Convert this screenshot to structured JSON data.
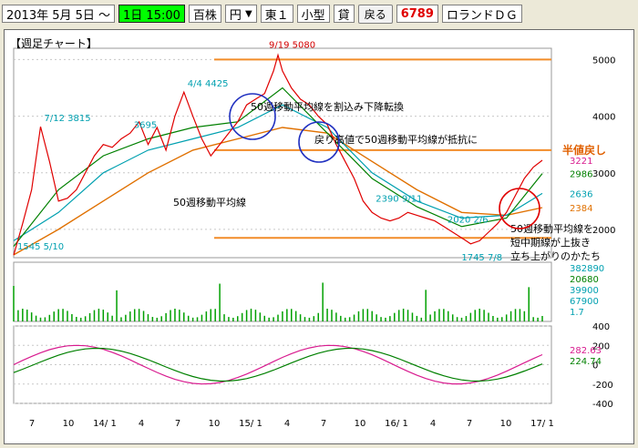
{
  "toolbar": {
    "date": "2013年 5月 5日 ～",
    "period": "1日 15:00",
    "unit_label": "百株",
    "currency": "円",
    "market": "東１",
    "size": "小型",
    "lend": "貸",
    "back_button": "戻る",
    "code": "6789",
    "company": "ロランドＤＧ"
  },
  "chart_data": {
    "type": "line",
    "title": "【週足チャート】",
    "price": {
      "ylim": [
        1500,
        5200
      ],
      "y_ticks": [
        "5000",
        "4000",
        "3000",
        "2000"
      ],
      "y_tick_values": [
        5000,
        4000,
        3000,
        2000
      ],
      "right_values": [
        {
          "text": "3221",
          "value": 3221,
          "color": "#d81b8f"
        },
        {
          "text": "2986",
          "value": 2986,
          "color": "#008000"
        },
        {
          "text": "2636",
          "value": 2636,
          "color": "#00a0b0"
        },
        {
          "text": "2384",
          "value": 2384,
          "color": "#e07000"
        }
      ],
      "price_series": [
        [
          0,
          1545
        ],
        [
          4,
          2100
        ],
        [
          8,
          2700
        ],
        [
          12,
          3815
        ],
        [
          16,
          3200
        ],
        [
          20,
          2500
        ],
        [
          24,
          2550
        ],
        [
          28,
          2700
        ],
        [
          32,
          3000
        ],
        [
          36,
          3300
        ],
        [
          40,
          3500
        ],
        [
          44,
          3450
        ],
        [
          48,
          3600
        ],
        [
          52,
          3700
        ],
        [
          56,
          3900
        ],
        [
          60,
          3500
        ],
        [
          64,
          3800
        ],
        [
          68,
          3400
        ],
        [
          72,
          4000
        ],
        [
          76,
          4425
        ],
        [
          80,
          4000
        ],
        [
          84,
          3600
        ],
        [
          88,
          3300
        ],
        [
          92,
          3500
        ],
        [
          96,
          3700
        ],
        [
          100,
          3900
        ],
        [
          104,
          4200
        ],
        [
          108,
          4300
        ],
        [
          112,
          4400
        ],
        [
          116,
          4800
        ],
        [
          118,
          5080
        ],
        [
          120,
          4800
        ],
        [
          124,
          4500
        ],
        [
          128,
          4300
        ],
        [
          132,
          4200
        ],
        [
          136,
          4000
        ],
        [
          140,
          3850
        ],
        [
          144,
          3500
        ],
        [
          148,
          3200
        ],
        [
          152,
          2900
        ],
        [
          156,
          2500
        ],
        [
          160,
          2300
        ],
        [
          164,
          2200
        ],
        [
          168,
          2150
        ],
        [
          172,
          2200
        ],
        [
          176,
          2300
        ],
        [
          180,
          2250
        ],
        [
          184,
          2200
        ],
        [
          188,
          2150
        ],
        [
          192,
          2050
        ],
        [
          196,
          1950
        ],
        [
          200,
          1850
        ],
        [
          204,
          1745
        ],
        [
          208,
          1800
        ],
        [
          212,
          1950
        ],
        [
          216,
          2100
        ],
        [
          220,
          2300
        ],
        [
          224,
          2600
        ],
        [
          228,
          2900
        ],
        [
          232,
          3100
        ],
        [
          236,
          3221
        ]
      ],
      "ma50": [
        [
          0,
          1550
        ],
        [
          20,
          2000
        ],
        [
          40,
          2500
        ],
        [
          60,
          3000
        ],
        [
          80,
          3400
        ],
        [
          100,
          3600
        ],
        [
          120,
          3800
        ],
        [
          140,
          3700
        ],
        [
          160,
          3200
        ],
        [
          180,
          2700
        ],
        [
          200,
          2300
        ],
        [
          220,
          2250
        ],
        [
          236,
          2384
        ]
      ],
      "ma_short": [
        [
          0,
          1700
        ],
        [
          20,
          2700
        ],
        [
          40,
          3300
        ],
        [
          60,
          3600
        ],
        [
          80,
          3800
        ],
        [
          100,
          3900
        ],
        [
          120,
          4500
        ],
        [
          140,
          3700
        ],
        [
          160,
          2900
        ],
        [
          180,
          2400
        ],
        [
          200,
          2050
        ],
        [
          220,
          2200
        ],
        [
          236,
          2986
        ]
      ],
      "ma_mid": [
        [
          0,
          1800
        ],
        [
          20,
          2300
        ],
        [
          40,
          3000
        ],
        [
          60,
          3400
        ],
        [
          80,
          3600
        ],
        [
          100,
          3800
        ],
        [
          120,
          4200
        ],
        [
          140,
          3800
        ],
        [
          160,
          3000
        ],
        [
          180,
          2500
        ],
        [
          200,
          2200
        ],
        [
          220,
          2250
        ],
        [
          236,
          2636
        ]
      ],
      "high": {
        "text": "9/19\n5080",
        "value": 5080
      },
      "low": {
        "text": "1745\n7/8",
        "value": 1745
      },
      "labels": [
        {
          "text": "7/12\n3815",
          "value": 3815
        },
        {
          "text": "4/4\n4425",
          "value": 4425
        },
        {
          "text": "2020\n2/6",
          "value": 2020
        },
        {
          "text": "3695",
          "value": 3695
        },
        {
          "text": "2390\n9/11",
          "value": 2390
        },
        {
          "text": "1545\n5/10",
          "value": 1545
        }
      ],
      "hlines": [
        {
          "value": 5000,
          "color": "#f28c28"
        },
        {
          "value": 3400,
          "color": "#f28c28",
          "label": "半値戻し"
        },
        {
          "value": 1850,
          "color": "#f28c28"
        }
      ],
      "annotations": [
        {
          "text": "50週移動平均線を割込み下降転換"
        },
        {
          "text": "戻り高値で50週移動平均線が抵抗に"
        },
        {
          "text": "50週移動平均線"
        },
        {
          "text": "50週移動平均線を\n短中期線が上抜き\n立ち上がりのかたち"
        }
      ]
    },
    "volume": {
      "y_ticks": [
        "382890",
        "20680",
        "39900",
        "67900",
        "1.7"
      ],
      "labels": [
        "382890",
        "20680",
        "39900",
        "67900",
        "1.7"
      ]
    },
    "oscillator": {
      "ylim": [
        -400,
        400
      ],
      "y_ticks": [
        "400",
        "200",
        "0",
        "-200",
        "-400"
      ],
      "values_label": [
        "282.63",
        "224.74"
      ]
    },
    "x_labels": [
      "7",
      "10",
      "14/ 1",
      "4",
      "7",
      "10",
      "15/ 1",
      "4",
      "7",
      "10",
      "16/ 1",
      "4",
      "7",
      "10",
      "17/ 1"
    ]
  }
}
